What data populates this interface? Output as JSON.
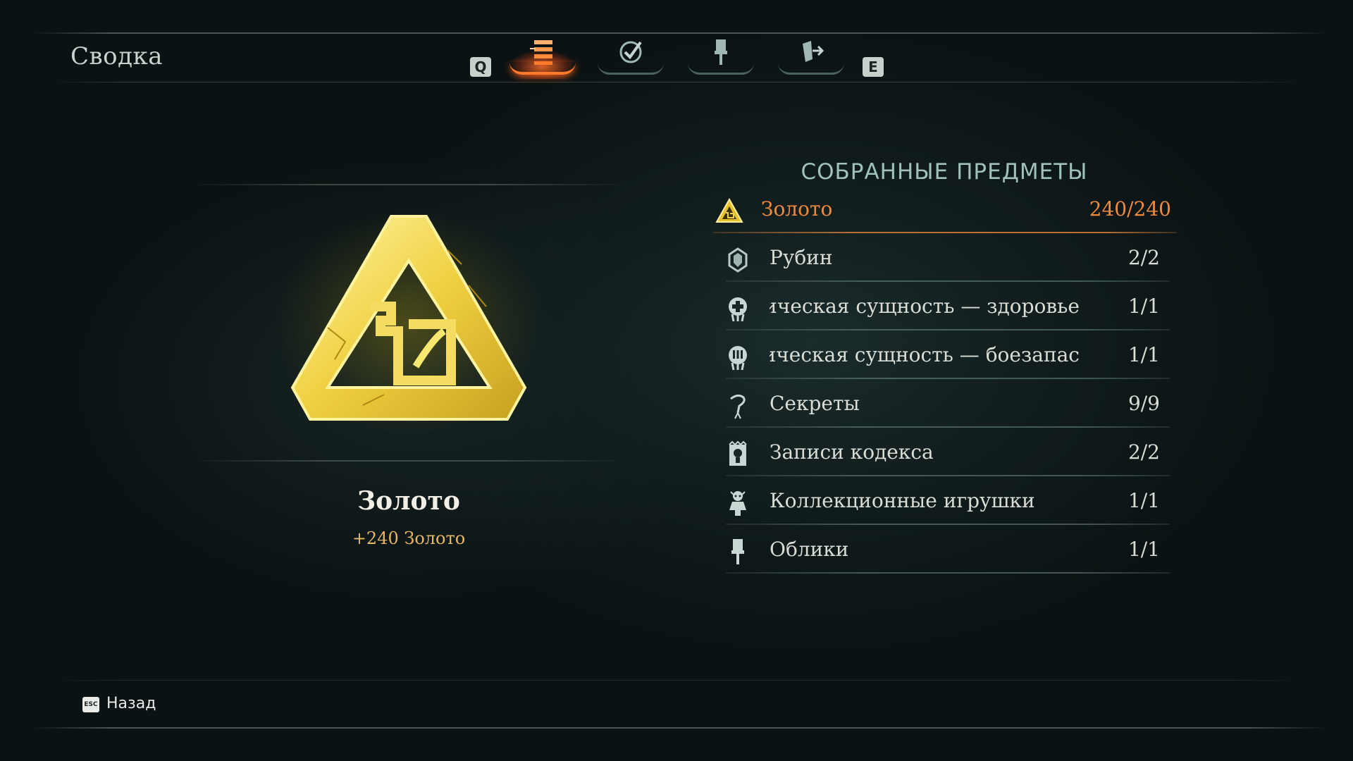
{
  "header": {
    "title": "Сводка",
    "key_prev": "Q",
    "key_next": "E",
    "tabs": [
      {
        "icon": "stacked-bars-icon",
        "active": true
      },
      {
        "icon": "checkmark-icon",
        "active": false
      },
      {
        "icon": "brush-icon",
        "active": false
      },
      {
        "icon": "hand-arrow-icon",
        "active": false
      }
    ]
  },
  "selected_item": {
    "name": "Золото",
    "description": "+240 Золото",
    "icon": "gold-triangle-emblem-icon"
  },
  "collected": {
    "title": "СОБРАННЫЕ ПРЕДМЕТЫ",
    "items": [
      {
        "label": "Золото",
        "count": "240/240",
        "icon": "gold-triangle-icon",
        "selected": true
      },
      {
        "label": "Рубин",
        "count": "2/2",
        "icon": "ruby-icon"
      },
      {
        "label": "ическая сущность — здоровье",
        "count": "1/1",
        "icon": "health-essence-icon"
      },
      {
        "label": "ическая сущность — боезапас",
        "count": "1/1",
        "icon": "ammo-essence-icon"
      },
      {
        "label": "Секреты",
        "count": "9/9",
        "icon": "secret-icon"
      },
      {
        "label": "Записи кодекса",
        "count": "2/2",
        "icon": "codex-icon"
      },
      {
        "label": "Коллекционные игрушки",
        "count": "1/1",
        "icon": "toy-icon"
      },
      {
        "label": "Облики",
        "count": "1/1",
        "icon": "skin-brush-icon"
      }
    ]
  },
  "footer": {
    "key": "ESC",
    "back_label": "Назад"
  },
  "colors": {
    "accent": "#f08a3a",
    "gold": "#e6b766",
    "title": "#9fc0bc"
  }
}
